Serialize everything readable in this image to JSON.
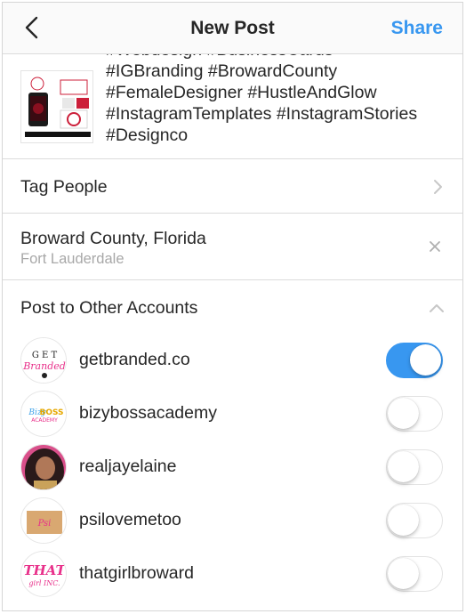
{
  "header": {
    "title": "New Post",
    "share_label": "Share",
    "back_icon": "back-chevron-icon"
  },
  "caption": {
    "text": "#Webdesign #BusinessCards\n#IGBranding #BrowardCounty\n#FemaleDesigner #HustleAndGlow\n#InstagramTemplates #InstagramStories\n#Designco"
  },
  "tag_people": {
    "label": "Tag People",
    "icon": "chevron-right-icon"
  },
  "location": {
    "name": "Broward County, Florida",
    "sub": "Fort Lauderdale",
    "icon": "clear-x-icon"
  },
  "other_accounts": {
    "label": "Post to Other Accounts",
    "icon": "chevron-up-icon",
    "accounts": [
      {
        "name": "getbranded.co",
        "on": true
      },
      {
        "name": "bizybossacademy",
        "on": false
      },
      {
        "name": "realjayelaine",
        "on": false
      },
      {
        "name": "psilovemetoo",
        "on": false
      },
      {
        "name": "thatgirlbroward",
        "on": false
      }
    ]
  },
  "colors": {
    "accent": "#3897f0",
    "text": "#262626",
    "muted": "#a8a8a8",
    "divider": "#dbdbdb"
  }
}
